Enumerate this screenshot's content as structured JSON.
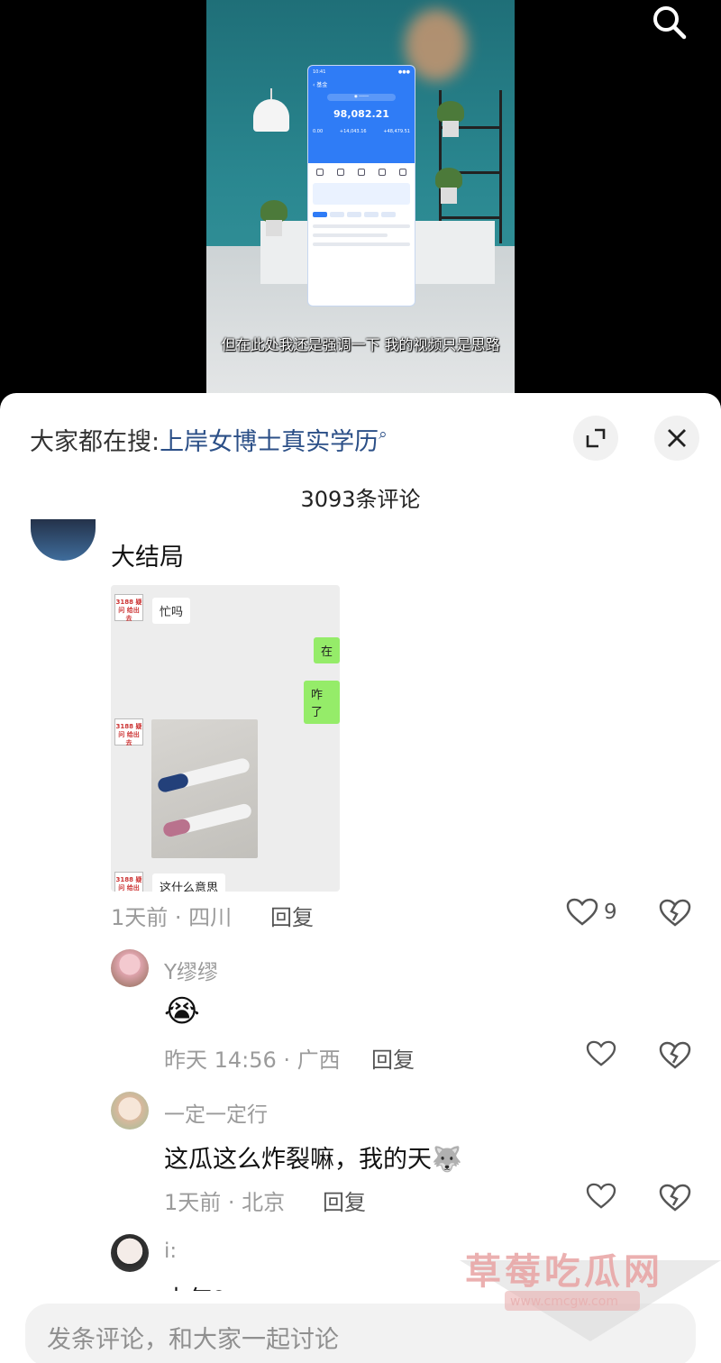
{
  "video": {
    "subtitle": "但在此处我还是强调一下 我的视频只是思路",
    "phone_amount": "98,082.21"
  },
  "sheet": {
    "hot_search_prefix": "大家都在搜:",
    "hot_search_keyword": "上岸女博士真实学历",
    "comment_count": "3093条评论"
  },
  "comments": [
    {
      "text": "大结局",
      "chat_image": {
        "bubbles": [
          "忙吗",
          "在",
          "咋了",
          "这什么意思"
        ],
        "avatar_label": "3188 疑问 给出去"
      },
      "time": "1天前 · 四川",
      "reply": "回复",
      "likes": "9"
    },
    {
      "name": "Y缪缪",
      "emoji": "😭",
      "time": "昨天 14:56 · 广西",
      "reply": "回复"
    },
    {
      "name": "一定一定行",
      "text": "这瓜这么炸裂嘛，我的天",
      "emoji": "🐺",
      "time": "1天前 · 北京",
      "reply": "回复"
    },
    {
      "name": "i:",
      "text": "去年?"
    }
  ],
  "input": {
    "placeholder": "发条评论，和大家一起讨论"
  },
  "watermark": {
    "title": "草莓吃瓜网",
    "url": "www.cmcgw.com"
  },
  "colors": {
    "keyword": "#2b4f87",
    "meta": "#9b9b9b",
    "sheet_bg": "#ffffff"
  }
}
